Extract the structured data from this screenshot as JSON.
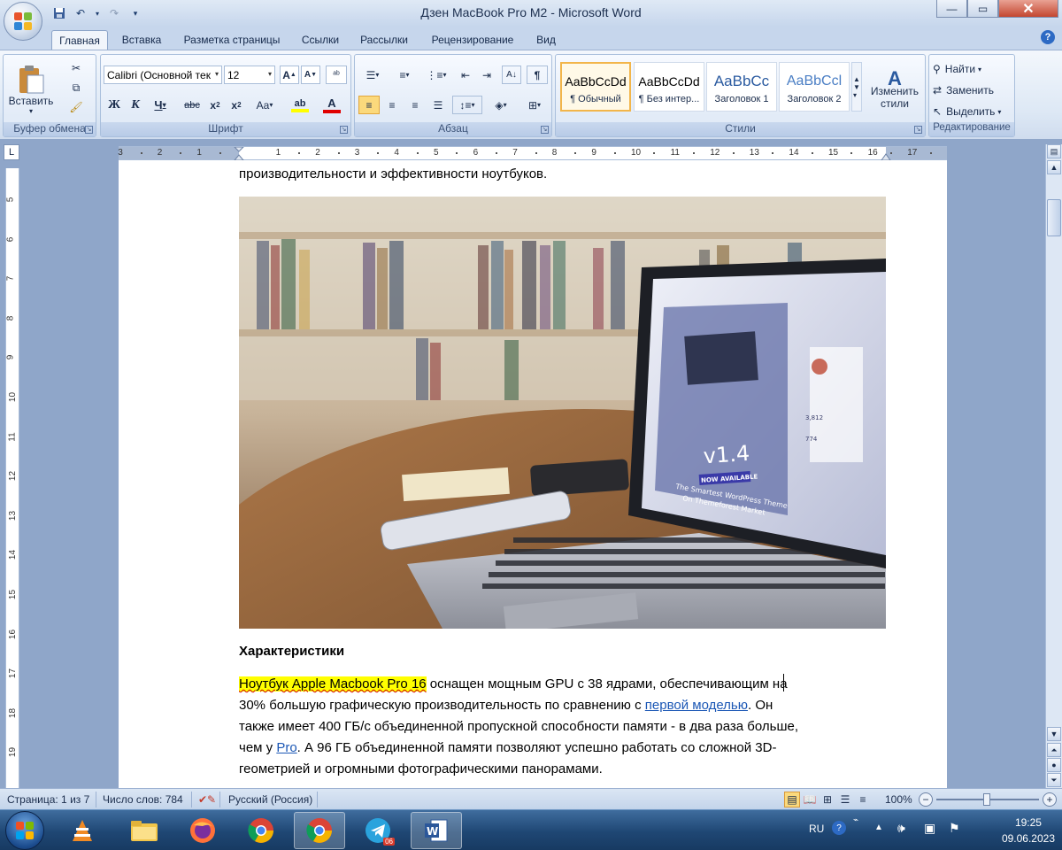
{
  "window": {
    "title": "Дзен MacBook Pro M2 - Microsoft Word",
    "qat": [
      "save-icon",
      "undo-icon",
      "redo-icon",
      "customize-icon"
    ]
  },
  "ribbon": {
    "tabs": [
      "Главная",
      "Вставка",
      "Разметка страницы",
      "Ссылки",
      "Рассылки",
      "Рецензирование",
      "Вид"
    ],
    "active_tab": "Главная",
    "clipboard": {
      "label": "Буфер обмена",
      "paste": "Вставить"
    },
    "font": {
      "label": "Шрифт",
      "family": "Calibri (Основной тек",
      "size": "12"
    },
    "paragraph": {
      "label": "Абзац"
    },
    "styles": {
      "label": "Стили",
      "items": [
        {
          "sample": "AaBbCcDd",
          "name": "¶ Обычный"
        },
        {
          "sample": "AaBbCcDd",
          "name": "¶ Без интер..."
        },
        {
          "sample": "AaBbCc",
          "name": "Заголовок 1"
        },
        {
          "sample": "AaBbCcl",
          "name": "Заголовок 2"
        }
      ],
      "change": "Изменить стили"
    },
    "editing": {
      "label": "Редактирование",
      "find": "Найти",
      "replace": "Заменить",
      "select": "Выделить"
    }
  },
  "ruler": {
    "numbers": [
      "3",
      "2",
      "1",
      "1",
      "2",
      "3",
      "4",
      "5",
      "6",
      "7",
      "8",
      "9",
      "10",
      "11",
      "12",
      "13",
      "14",
      "15",
      "16",
      "17"
    ],
    "vnumbers": [
      "5",
      "6",
      "7",
      "8",
      "9",
      "10",
      "11",
      "12",
      "13",
      "14",
      "15",
      "16",
      "17",
      "18",
      "19"
    ]
  },
  "document": {
    "line_top": "производительности и эффективности ноутбуков.",
    "heading": "Характеристики",
    "p1_highlight": "Ноутбук Apple Macbook Pro 16",
    "p1_rest": " оснащен мощным GPU с 38 ядрами, обеспечивающим на",
    "p2a": "30% большую графическую производительность по сравнению с ",
    "p2_link": "первой моделью",
    "p2b": ". Он",
    "p3": "также имеет 400 ГБ/с объединенной пропускной способности памяти - в два раза больше,",
    "p4a": "чем у ",
    "p4_link": "Pro",
    "p4b": ". А 96 ГБ объединенной памяти позволяют успешно работать со сложной 3D-",
    "p5": "геометрией и огромными фотографическими панорамами.",
    "photo_screen": {
      "version": "v1.4",
      "badge": "NOW AVAILABLE",
      "tagline1": "The Smartest WordPress Theme",
      "tagline2": "On Themeforest Market",
      "stat1": "3,812",
      "stat2": "774"
    }
  },
  "status": {
    "page": "Страница: 1 из 7",
    "words": "Число слов: 784",
    "language": "Русский (Россия)",
    "zoom": "100%"
  },
  "taskbar": {
    "apps": [
      "vlc-icon",
      "file-explorer-icon",
      "firefox-icon",
      "chrome-icon",
      "chrome-icon",
      "telegram-icon",
      "word-icon"
    ],
    "telegram_badge": "06",
    "lang": "RU",
    "time": "19:25",
    "date": "09.06.2023"
  }
}
